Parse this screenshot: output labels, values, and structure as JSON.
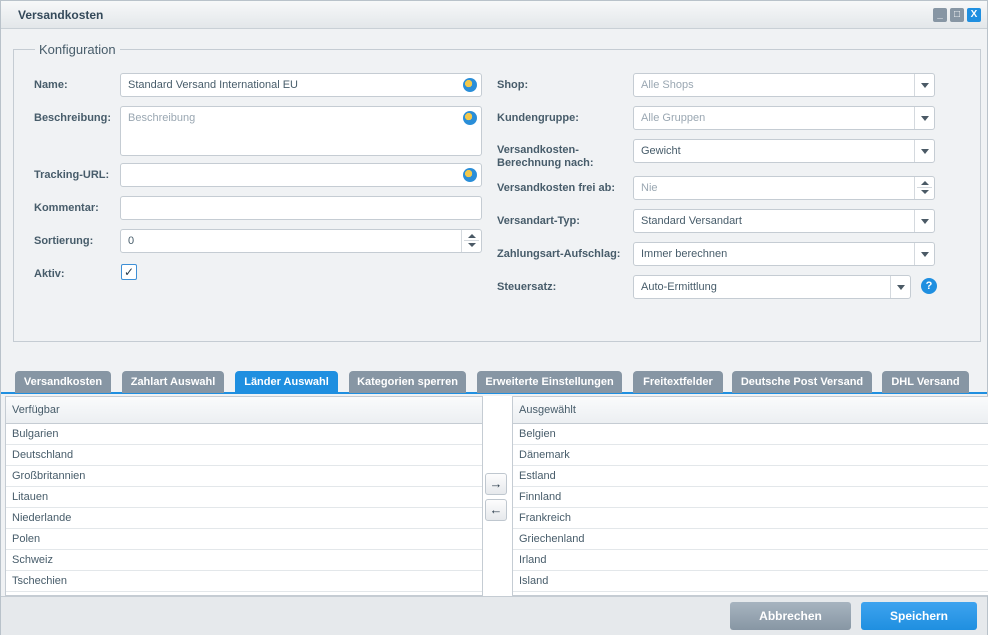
{
  "window": {
    "title": "Versandkosten",
    "minimize": "_",
    "maximize": "□",
    "close": "X"
  },
  "config": {
    "legend": "Konfiguration",
    "name_label": "Name:",
    "name_value": "Standard Versand International EU",
    "beschreibung_label": "Beschreibung:",
    "beschreibung_placeholder": "Beschreibung",
    "tracking_label": "Tracking-URL:",
    "tracking_value": "",
    "kommentar_label": "Kommentar:",
    "kommentar_value": "",
    "sortierung_label": "Sortierung:",
    "sortierung_value": "0",
    "aktiv_label": "Aktiv:",
    "aktiv_checked": "✓",
    "shop_label": "Shop:",
    "shop_value": "Alle Shops",
    "kundengruppe_label": "Kundengruppe:",
    "kundengruppe_value": "Alle Gruppen",
    "berechnung_label_1": "Versandkosten-",
    "berechnung_label_2": "Berechnung nach:",
    "berechnung_value": "Gewicht",
    "frei_label": "Versandkosten frei ab:",
    "frei_value": "Nie",
    "typ_label": "Versandart-Typ:",
    "typ_value": "Standard Versandart",
    "aufschlag_label": "Zahlungsart-Aufschlag:",
    "aufschlag_value": "Immer berechnen",
    "steuer_label": "Steuersatz:",
    "steuer_value": "Auto-Ermittlung",
    "help": "?"
  },
  "tabs": [
    {
      "label": "Versandkosten"
    },
    {
      "label": "Zahlart Auswahl"
    },
    {
      "label": "Länder Auswahl"
    },
    {
      "label": "Kategorien sperren"
    },
    {
      "label": "Erweiterte Einstellungen"
    },
    {
      "label": "Freitextfelder"
    },
    {
      "label": "Deutsche Post Versand"
    },
    {
      "label": "DHL Versand"
    }
  ],
  "available": {
    "header": "Verfügbar",
    "rows": [
      "Bulgarien",
      "Deutschland",
      "Großbritannien",
      "Litauen",
      "Niederlande",
      "Polen",
      "Schweiz",
      "Tschechien"
    ]
  },
  "selected": {
    "header": "Ausgewählt",
    "rows": [
      "Belgien",
      "Dänemark",
      "Estland",
      "Finnland",
      "Frankreich",
      "Griechenland",
      "Irland",
      "Island"
    ]
  },
  "transfer": {
    "add": "→",
    "remove": "←"
  },
  "footer": {
    "cancel": "Abbrechen",
    "save": "Speichern"
  }
}
